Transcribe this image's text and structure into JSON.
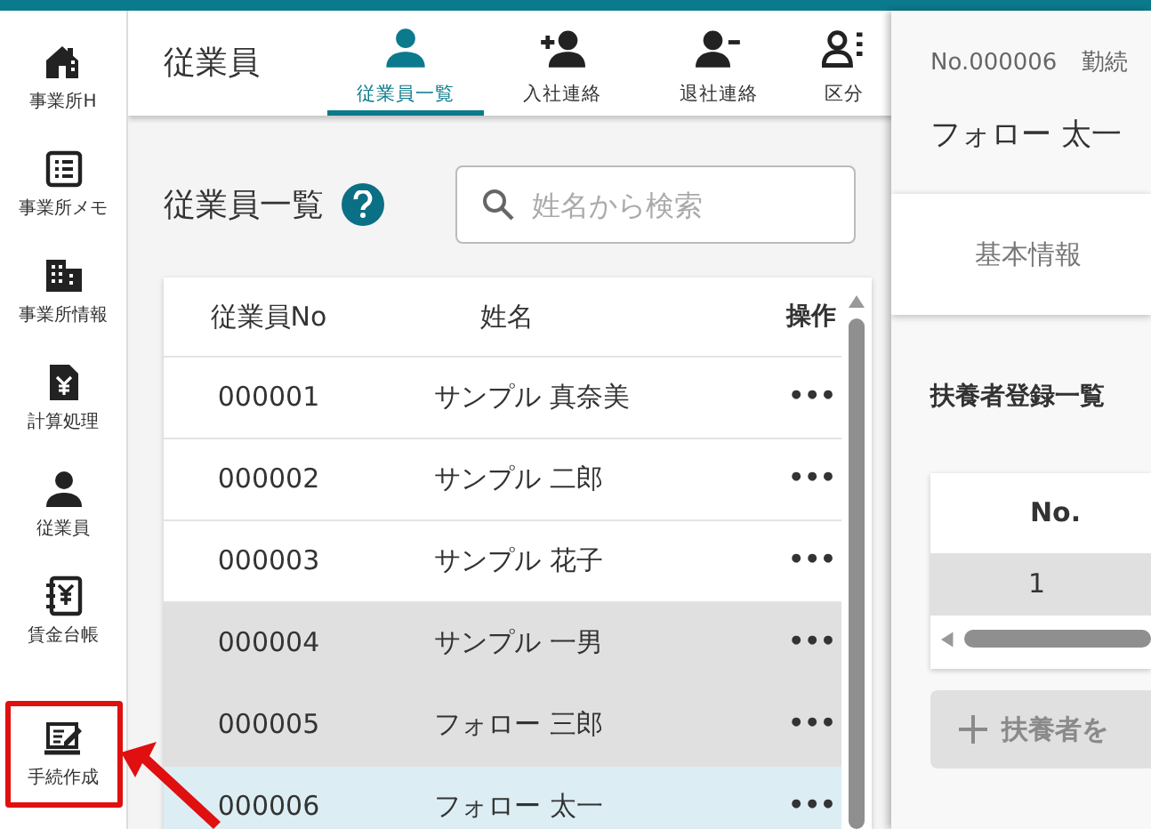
{
  "sidebar": {
    "items": [
      {
        "label": "事業所H",
        "highlighted": false
      },
      {
        "label": "事業所メモ",
        "highlighted": false
      },
      {
        "label": "事業所情報",
        "highlighted": false
      },
      {
        "label": "計算処理",
        "highlighted": false
      },
      {
        "label": "従業員",
        "highlighted": false
      },
      {
        "label": "賃金台帳",
        "highlighted": false
      },
      {
        "label": "手続作成",
        "highlighted": true
      }
    ]
  },
  "header": {
    "title": "従業員",
    "tabs": [
      {
        "label": "従業員一覧",
        "selected": true
      },
      {
        "label": "入社連絡",
        "selected": false
      },
      {
        "label": "退社連絡",
        "selected": false
      },
      {
        "label": "区分",
        "selected": false
      }
    ]
  },
  "list": {
    "title": "従業員一覧",
    "search": {
      "placeholder": "姓名から検索"
    },
    "columns": [
      "従業員No",
      "姓名",
      "操作"
    ],
    "rows": [
      {
        "no": "000001",
        "name": "サンプル 真奈美",
        "action": "•••",
        "shaded": false,
        "selected": false
      },
      {
        "no": "000002",
        "name": "サンプル 二郎",
        "action": "•••",
        "shaded": false,
        "selected": false
      },
      {
        "no": "000003",
        "name": "サンプル 花子",
        "action": "•••",
        "shaded": false,
        "selected": false
      },
      {
        "no": "000004",
        "name": "サンプル 一男",
        "action": "•••",
        "shaded": true,
        "selected": false
      },
      {
        "no": "000005",
        "name": "フォロー 三郎",
        "action": "•••",
        "shaded": true,
        "selected": false
      },
      {
        "no": "000006",
        "name": "フォロー 太一",
        "action": "•••",
        "shaded": false,
        "selected": true
      }
    ]
  },
  "detail": {
    "employee_no": "No.000006",
    "tenure": "勤続",
    "name": "フォロー 太一",
    "tab": "基本情報",
    "section_title": "扶養者登録一覧",
    "table": {
      "columns": [
        "No."
      ],
      "rows": [
        [
          "1"
        ]
      ]
    },
    "add_button": {
      "label": "扶養者を",
      "disabled": true
    }
  }
}
